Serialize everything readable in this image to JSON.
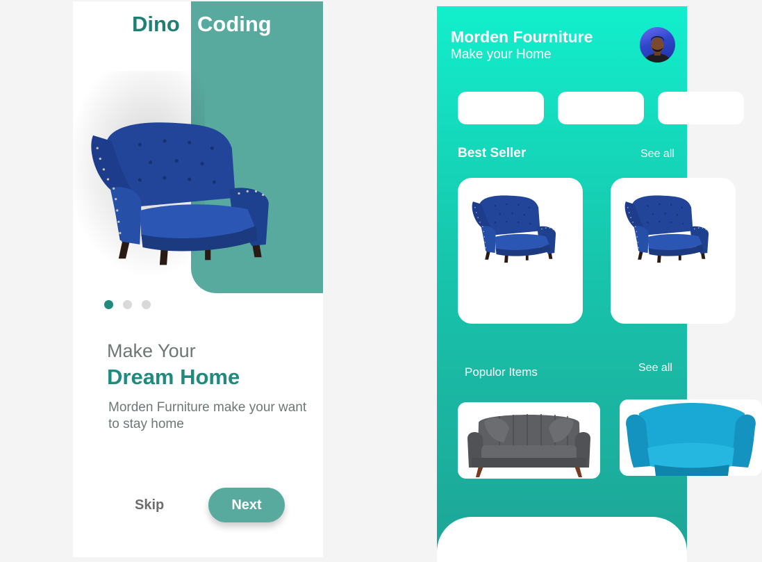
{
  "onboarding": {
    "brand": {
      "word1": "Dino",
      "word2": "Coding"
    },
    "page_indicator": {
      "count": 3,
      "active": 1
    },
    "heading_line1": "Make Your",
    "heading_line2": "Dream Home",
    "description": "Morden Furniture make your want to stay home",
    "skip_label": "Skip",
    "next_label": "Next"
  },
  "home": {
    "title": "Morden Fourniture",
    "subtitle": "Make your Home",
    "avatar_icon": "user-avatar",
    "categories": [
      "",
      "",
      ""
    ],
    "best_seller": {
      "title": "Best Seller",
      "see_all": "See all",
      "items": [
        {
          "image": "blue-armchair"
        },
        {
          "image": "blue-armchair"
        }
      ]
    },
    "popular": {
      "title": "Populor Items",
      "see_all": "See all",
      "items": [
        {
          "image": "grey-sofa"
        },
        {
          "image": "cyan-armchair"
        }
      ]
    }
  },
  "colors": {
    "brand_teal": "#1f8a7e",
    "panel_teal": "#58a99e",
    "gradient_top": "#12efcc",
    "gradient_bottom": "#1ea497",
    "chair_blue": "#1f3f8a"
  }
}
